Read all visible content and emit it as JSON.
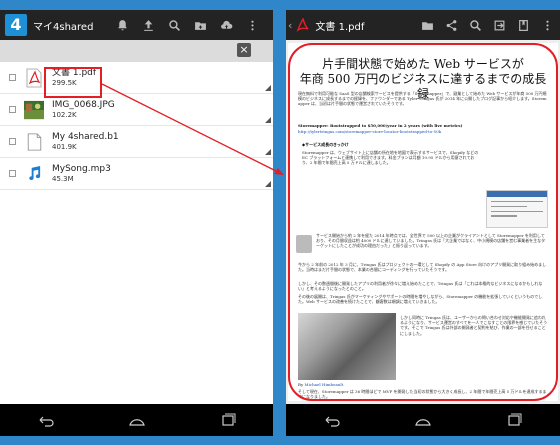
{
  "left": {
    "app_logo": "4",
    "title": "マイ4shared",
    "toolbar_icons": [
      "bell-icon",
      "upload-icon",
      "search-icon",
      "new-folder-icon",
      "cloud-upload-icon",
      "overflow-icon"
    ],
    "close_label": "×",
    "files": [
      {
        "name": "文書 1.pdf",
        "size": "299.5K",
        "icon": "pdf-icon"
      },
      {
        "name": "IMG_0068.JPG",
        "size": "102.2K",
        "icon": "image-thumbnail"
      },
      {
        "name": "My 4shared.b1",
        "size": "401.9K",
        "icon": "document-icon"
      },
      {
        "name": "MySong.mp3",
        "size": "45.3M",
        "icon": "music-note-icon"
      }
    ]
  },
  "right": {
    "title": "文書 1.pdf",
    "toolbar_icons": [
      "folder-icon",
      "share-icon",
      "search-icon",
      "export-icon",
      "bookmark-icon",
      "overflow-icon"
    ],
    "document": {
      "heading_line1": "片手間状態で始めた Web サービスが",
      "heading_line2": "年商 500 万円のビジネスに達するまでの成長録",
      "intro": "現在無料で利用可能な SaaS 型の店舗検索サービスを提供する「Storemapper」で、副業として始めた Web サービスが年商 500 万円規模のビジネスに成長するまでの経緯を、ファウンダーである Tyler Tringas 氏が 2014 年に公開したブログ記事から紹介します。Storemapper は、当初は片手間の状態で運営されていたそうです。",
      "subtitle": "Storemapper: Bootstrapped to $50,000/year in 2 years (with live metrics)",
      "url": "http://tylertringas.com/storemapper-store-locator-bootstrapped-to-50k",
      "section_heading": "◆サービス成長のきっかけ",
      "section_body": "Storemapper は、ウェブサイト上に店舗の所在地を地図で表示するサービスで、Shopify などの EC プラットフォームと連携して利用できます。料金プランは月額 19.95 ドルから用意されており、2 年間で年間売上高 5 万ドルに達しました。",
      "para_2": "サービス開始から約 2 年を経た 2014 年時点では、全世界で 500 以上の企業がクライアントとして Storemapper を利用しており、その月間収益は約 4000 ドルに達していました。Tringas 氏は「大企業ではなく、中小規模の店舗を営む事業者を主なターゲットにしたことが成功の理由だった」と振り返っています。",
      "para_3": "今から 2 年前の 2012 年 3 月に、Tringas 氏はプロジェクトの一環として Shopify の App Store 向けのアプリ開発に取り組み始めました。当時はまだ片手間の状態で、本業の合間にコーディングを行っていたそうです。",
      "para_4": "しかし、その数週間後に開発したアプリの利用者が徐々に増え始めたことで、Tringas 氏は「これは本格的なビジネスになるかもしれない」と考えるようになったとのこと。",
      "para_5": "その後の展開は、Tringas 氏がマーケティングやサポートの時間を増やしながら、Storemapper の機能を拡張していくというものでした。Web サービスの改善を続けたことで、顧客数は順調に増えていきました。",
      "para_6": "しかし同時に Tringas 氏は、ユーザーからの問い合わせ対応や機能開発に追われるようになり、サービス運営のすべてを一人でこなすことの限界を感じていたそうです。そこで Tringas 氏は外部の開発者と契約を結び、作業の一部を任せることにしました。",
      "caption_prefix": "By",
      "caption_author": "Michael Himbeault",
      "para_7": "そして現在、Storemapper は 36 時間ほどで MVP を開発した当初の状態から大きく成長し、2 年間で年間売上高 5 万ドルを達成するまでになりました。"
    }
  }
}
